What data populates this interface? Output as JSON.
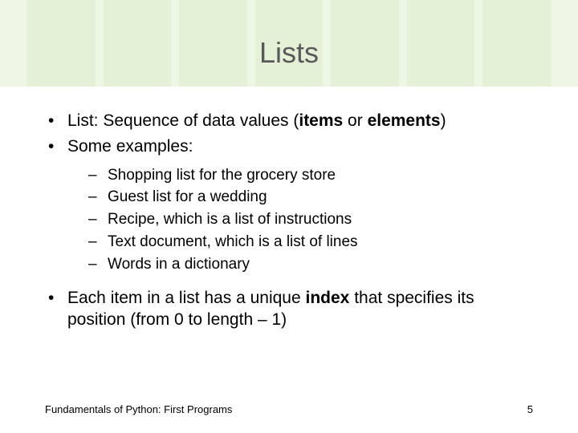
{
  "title": "Lists",
  "bullets": {
    "b1_pre": "List: Sequence of data values (",
    "b1_bold1": "items",
    "b1_mid": " or ",
    "b1_bold2": "elements",
    "b1_post": ")",
    "b2": "Some examples:",
    "b3_pre": "Each item in a list has a unique ",
    "b3_bold": "index",
    "b3_post": " that specifies its position (from 0 to length – 1)"
  },
  "subs": {
    "s1": "Shopping list for the grocery store",
    "s2": "Guest list for a wedding",
    "s3": "Recipe, which is a list of instructions",
    "s4": "Text document, which is a list of lines",
    "s5": "Words in a dictionary"
  },
  "footer": {
    "left": "Fundamentals of Python: First Programs",
    "right": "5"
  },
  "glyphs": {
    "bullet": "•",
    "dash": "–"
  }
}
